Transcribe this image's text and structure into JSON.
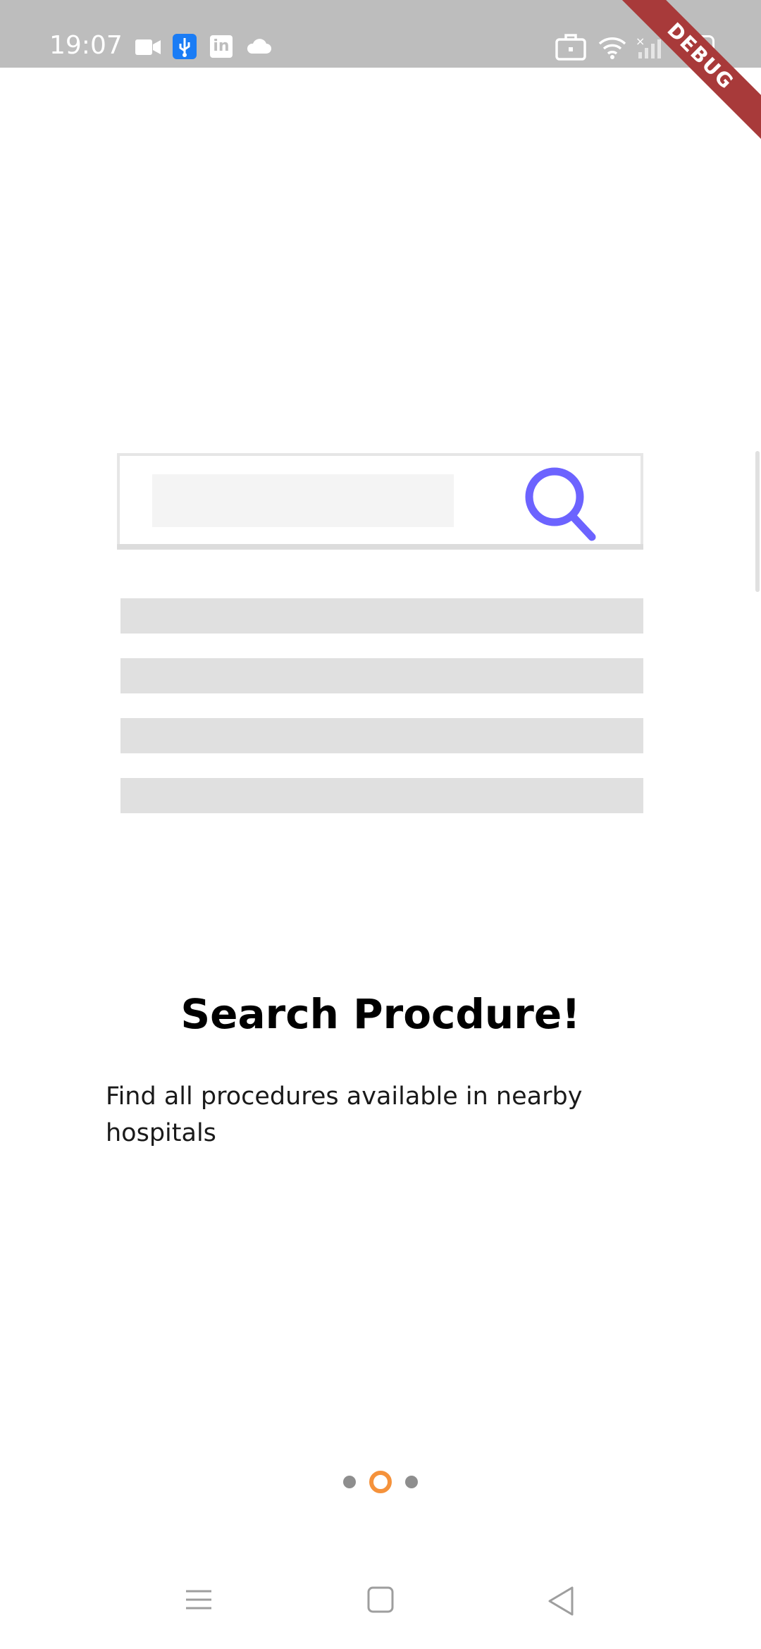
{
  "status_bar": {
    "time": "19:07",
    "left_icons": [
      "video-camera-icon",
      "usb-icon",
      "linkedin-icon",
      "cloud-icon"
    ],
    "right_icons": [
      "briefcase-icon",
      "wifi-icon",
      "cellular-signal-icon",
      "battery-icon"
    ],
    "battery_level": "100"
  },
  "debug_banner": "DEBUG",
  "onboarding": {
    "title": "Search Procdure!",
    "description": "Find all procedures available in nearby hospitals",
    "pages_total": 3,
    "current_page": 2
  },
  "colors": {
    "accent": "#6c63ff",
    "indicator_active": "#f5923b",
    "indicator_inactive": "#8e8e8e",
    "placeholder": "#e0e0e0"
  },
  "nav_bar": [
    "menu-icon",
    "home-icon",
    "back-icon"
  ]
}
